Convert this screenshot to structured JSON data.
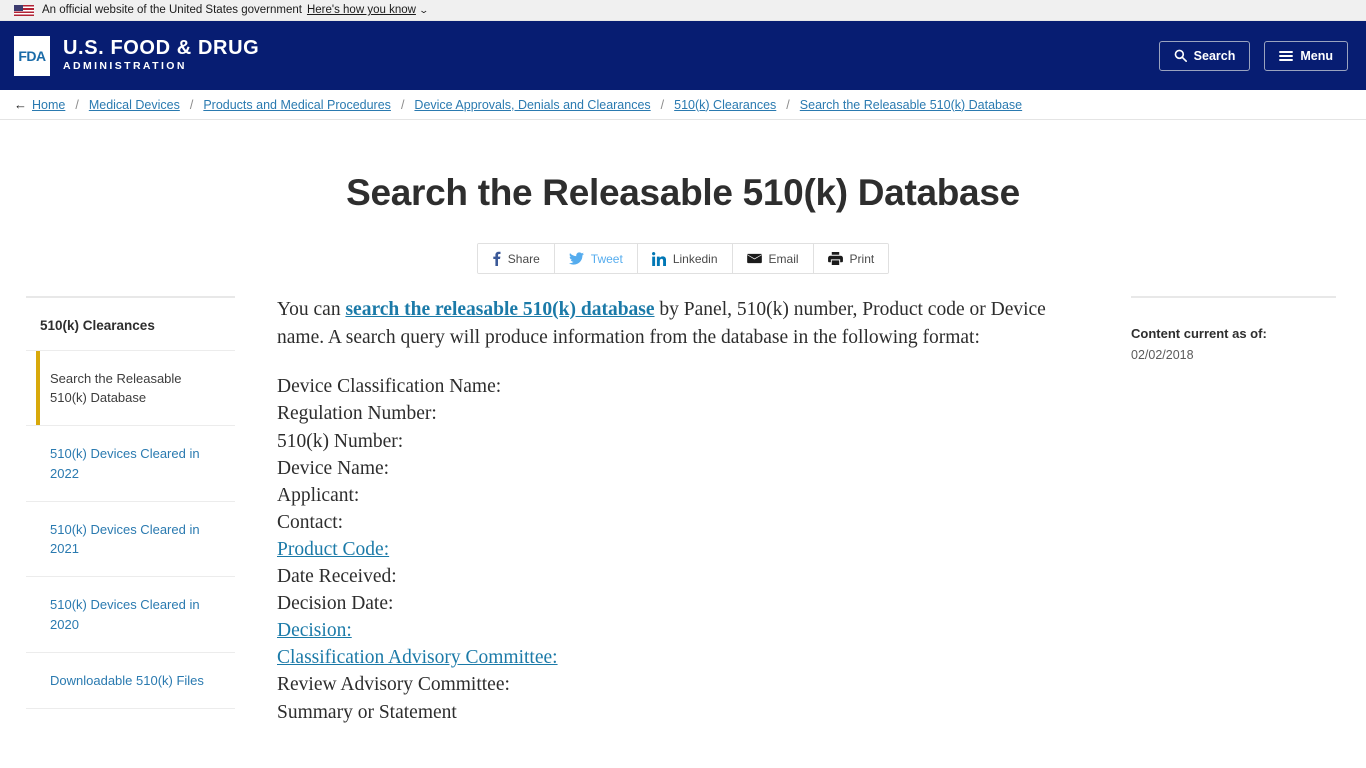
{
  "usa_banner": {
    "text": "An official website of the United States government",
    "link_label": "Here's how you know",
    "flag_icon": "us-flag-icon",
    "chevron_icon": "chevron-down-icon"
  },
  "header": {
    "logo_mark": "FDA",
    "logo_line1": "U.S. FOOD & DRUG",
    "logo_line2": "ADMINISTRATION",
    "search_label": "Search",
    "menu_label": "Menu",
    "search_icon": "search-icon",
    "menu_icon": "hamburger-icon",
    "navy": "#071d72"
  },
  "breadcrumb": {
    "back_arrow": "←",
    "separator": "/",
    "items": [
      {
        "label": "Home"
      },
      {
        "label": "Medical Devices"
      },
      {
        "label": "Products and Medical Procedures"
      },
      {
        "label": "Device Approvals, Denials and Clearances"
      },
      {
        "label": "510(k) Clearances"
      },
      {
        "label": "Search the Releasable 510(k) Database"
      }
    ]
  },
  "page": {
    "title": "Search the Releasable 510(k) Database"
  },
  "share_bar": {
    "items": [
      {
        "label": "Share",
        "icon": "facebook-icon",
        "color": "#3b5998"
      },
      {
        "label": "Tweet",
        "icon": "twitter-icon",
        "color": "#55acee"
      },
      {
        "label": "Linkedin",
        "icon": "linkedin-icon",
        "color": "#0077b5"
      },
      {
        "label": "Email",
        "icon": "envelope-icon",
        "color": "#1b1b1b"
      },
      {
        "label": "Print",
        "icon": "printer-icon",
        "color": "#1b1b1b"
      }
    ]
  },
  "sidebar": {
    "title": "510(k) Clearances",
    "items": [
      {
        "label": "Search the Releasable 510(k) Database",
        "active": true
      },
      {
        "label": "510(k) Devices Cleared in 2022",
        "active": false
      },
      {
        "label": "510(k) Devices Cleared in 2021",
        "active": false
      },
      {
        "label": "510(k) Devices Cleared in 2020",
        "active": false
      },
      {
        "label": "Downloadable 510(k) Files",
        "active": false
      }
    ],
    "active_accent": "#d8a90b"
  },
  "main": {
    "intro": {
      "lead": "You can ",
      "link": "search the releasable 510(k) database",
      "tail": " by Panel, 510(k) number, Product code or Device name. A search query will produce information from the database in the following format:"
    },
    "fields": [
      {
        "label": "Device Classification Name:",
        "is_link": false
      },
      {
        "label": "Regulation Number:",
        "is_link": false
      },
      {
        "label": "510(k) Number:",
        "is_link": false
      },
      {
        "label": "Device Name:",
        "is_link": false
      },
      {
        "label": "Applicant:",
        "is_link": false
      },
      {
        "label": "Contact:",
        "is_link": false
      },
      {
        "label": "Product Code:",
        "is_link": true
      },
      {
        "label": "Date Received:",
        "is_link": false
      },
      {
        "label": "Decision Date:",
        "is_link": false
      },
      {
        "label": "Decision:",
        "is_link": true
      },
      {
        "label": "Classification Advisory Committee:",
        "is_link": true
      },
      {
        "label": "Review Advisory Committee:",
        "is_link": false
      },
      {
        "label": "Summary or Statement",
        "is_link": false
      }
    ]
  },
  "right_sidebar": {
    "label": "Content current as of:",
    "value": "02/02/2018"
  }
}
